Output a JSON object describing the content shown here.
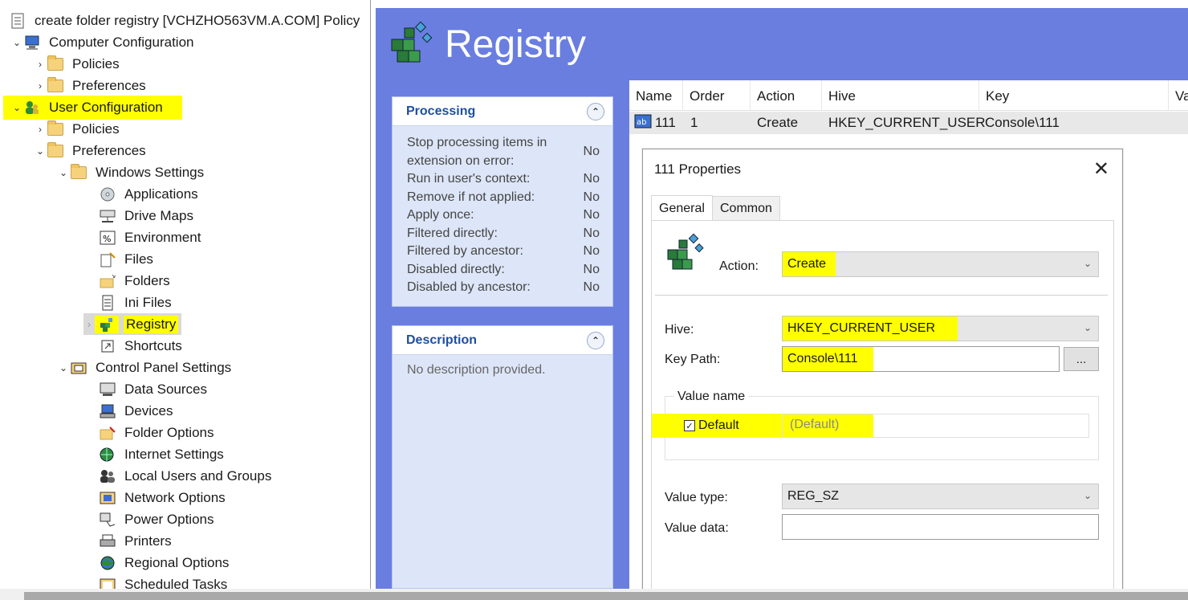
{
  "tree": {
    "root_label": "create folder registry [VCHZHO563VM.A.COM] Policy",
    "computer_config": "Computer Configuration",
    "cc_policies": "Policies",
    "cc_preferences": "Preferences",
    "user_config": "User Configuration",
    "uc_policies": "Policies",
    "uc_preferences": "Preferences",
    "windows_settings": "Windows Settings",
    "ws_items": [
      "Applications",
      "Drive Maps",
      "Environment",
      "Files",
      "Folders",
      "Ini Files",
      "Registry",
      "Shortcuts"
    ],
    "control_panel": "Control Panel Settings",
    "cp_items": [
      "Data Sources",
      "Devices",
      "Folder Options",
      "Internet Settings",
      "Local Users and Groups",
      "Network Options",
      "Power Options",
      "Printers",
      "Regional Options",
      "Scheduled Tasks"
    ]
  },
  "right": {
    "title": "Registry",
    "processing": {
      "title": "Processing",
      "rows": [
        {
          "label": "Stop processing items in extension on error:",
          "value": "No"
        },
        {
          "label": "Run in user's context:",
          "value": "No"
        },
        {
          "label": "Remove if not applied:",
          "value": "No"
        },
        {
          "label": "Apply once:",
          "value": "No"
        },
        {
          "label": "Filtered directly:",
          "value": "No"
        },
        {
          "label": "Filtered by ancestor:",
          "value": "No"
        },
        {
          "label": "Disabled directly:",
          "value": "No"
        },
        {
          "label": "Disabled by ancestor:",
          "value": "No"
        }
      ]
    },
    "description": {
      "title": "Description",
      "text": "No description provided."
    },
    "list": {
      "columns": [
        "Name",
        "Order",
        "Action",
        "Hive",
        "Key",
        "Va"
      ],
      "row": {
        "name": "111",
        "order": "1",
        "action": "Create",
        "hive": "HKEY_CURRENT_USER",
        "key": "Console\\111"
      }
    }
  },
  "dialog": {
    "title": "111 Properties",
    "close": "✕",
    "tabs": [
      "General",
      "Common"
    ],
    "action_label": "Action:",
    "action_value": "Create",
    "hive_label": "Hive:",
    "hive_value": "HKEY_CURRENT_USER",
    "keypath_label": "Key Path:",
    "keypath_value": "Console\\111",
    "browse_label": "...",
    "value_name_group": "Value name",
    "default_label": "Default",
    "default_checked": true,
    "default_placeholder": "(Default)",
    "value_type_label": "Value type:",
    "value_type_value": "REG_SZ",
    "value_data_label": "Value data:",
    "value_data_value": ""
  },
  "colors": {
    "highlight": "#ffff00",
    "pane_blue": "#6a7ee0",
    "link_blue": "#1f4fa0"
  }
}
